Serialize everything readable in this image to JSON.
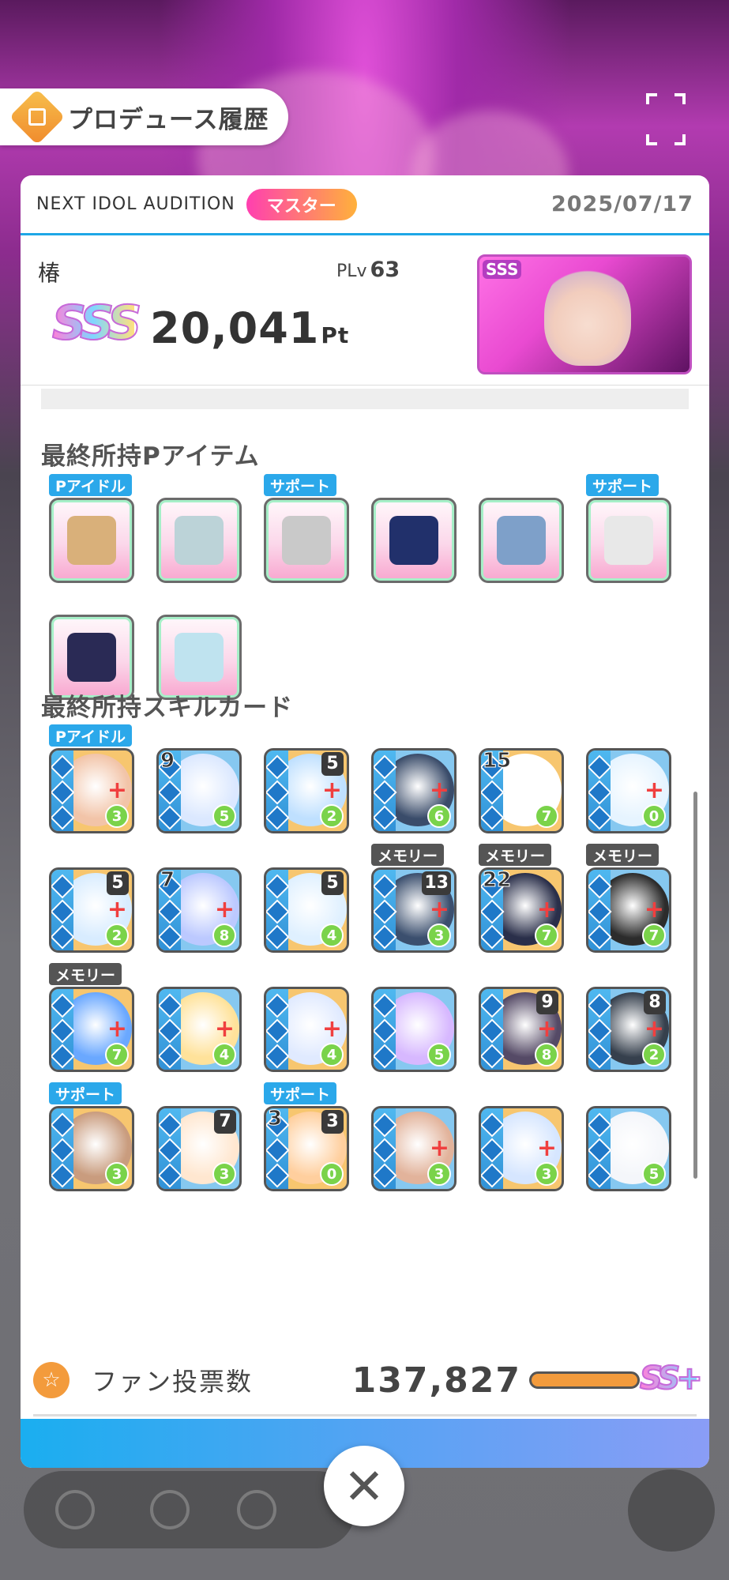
{
  "history_tab": {
    "title": "プロデュース履歴"
  },
  "header": {
    "audition": "NEXT IDOL AUDITION",
    "difficulty": "マスター",
    "date": "2025/07/17"
  },
  "summary": {
    "name": "椿",
    "plv_label": "PLv",
    "plv_value": "63",
    "rank": "SSS",
    "score": "20,041",
    "score_unit": "Pt",
    "card_rank": "SSS"
  },
  "sections": {
    "items_title": "最終所持Pアイテム",
    "skills_title": "最終所持スキルカード"
  },
  "items": [
    {
      "icon": "mittens-icon",
      "tag": "Pアイドル"
    },
    {
      "icon": "nia-bag-icon",
      "tag": ""
    },
    {
      "icon": "notebook-icon",
      "tag": "サポート"
    },
    {
      "icon": "nia-tag-icon",
      "tag": ""
    },
    {
      "icon": "hair-tie-icon",
      "tag": ""
    },
    {
      "icon": "desk-lamp-icon",
      "tag": "サポート"
    },
    {
      "icon": "police-cap-icon",
      "tag": ""
    },
    {
      "icon": "crystal-pendant-icon",
      "tag": ""
    }
  ],
  "skills": [
    {
      "tag": "Pアイドル",
      "lvl": "",
      "num": "",
      "cost": "3",
      "plus": true
    },
    {
      "tag": "",
      "lvl": "",
      "num": "9",
      "cost": "5",
      "plus": false
    },
    {
      "tag": "",
      "lvl": "5",
      "num": "",
      "cost": "2",
      "plus": true
    },
    {
      "tag": "",
      "lvl": "",
      "num": "",
      "cost": "6",
      "plus": true
    },
    {
      "tag": "",
      "lvl": "",
      "num": "15",
      "cost": "7",
      "plus": false
    },
    {
      "tag": "",
      "lvl": "",
      "num": "",
      "cost": "0",
      "plus": true
    },
    {
      "tag": "",
      "lvl": "5",
      "num": "",
      "cost": "2",
      "plus": true
    },
    {
      "tag": "",
      "lvl": "",
      "num": "7",
      "cost": "8",
      "plus": true
    },
    {
      "tag": "",
      "lvl": "5",
      "num": "",
      "cost": "4",
      "plus": false
    },
    {
      "tag": "メモリー",
      "lvl": "13",
      "num": "",
      "cost": "3",
      "plus": true
    },
    {
      "tag": "メモリー",
      "lvl": "",
      "num": "22",
      "cost": "7",
      "plus": true
    },
    {
      "tag": "メモリー",
      "lvl": "",
      "num": "",
      "cost": "7",
      "plus": true
    },
    {
      "tag": "メモリー",
      "lvl": "",
      "num": "",
      "cost": "7",
      "plus": true
    },
    {
      "tag": "",
      "lvl": "",
      "num": "",
      "cost": "4",
      "plus": true
    },
    {
      "tag": "",
      "lvl": "",
      "num": "",
      "cost": "4",
      "plus": true
    },
    {
      "tag": "",
      "lvl": "",
      "num": "",
      "cost": "5",
      "plus": false
    },
    {
      "tag": "",
      "lvl": "9",
      "num": "",
      "cost": "8",
      "plus": true
    },
    {
      "tag": "",
      "lvl": "8",
      "num": "",
      "cost": "2",
      "plus": true
    },
    {
      "tag": "サポート",
      "lvl": "",
      "num": "",
      "cost": "3",
      "plus": false
    },
    {
      "tag": "",
      "lvl": "7",
      "num": "",
      "cost": "3",
      "plus": false
    },
    {
      "tag": "サポート",
      "lvl": "3",
      "num": "3",
      "cost": "0",
      "plus": false
    },
    {
      "tag": "",
      "lvl": "",
      "num": "",
      "cost": "3",
      "plus": true
    },
    {
      "tag": "",
      "lvl": "",
      "num": "",
      "cost": "3",
      "plus": true
    },
    {
      "tag": "",
      "lvl": "",
      "num": "",
      "cost": "5",
      "plus": false
    }
  ],
  "fan": {
    "label": "ファン投票数",
    "value": "137,827",
    "rank": "SS+",
    "rank_bar_fill": 1.0
  },
  "colors": {
    "accent": "#1ea7e6",
    "badge_start": "#ff3fb0",
    "badge_end": "#ffb13b",
    "cost_green": "#7ad34a",
    "tag_blue": "#2ba8ea",
    "tag_memory": "#555555"
  }
}
